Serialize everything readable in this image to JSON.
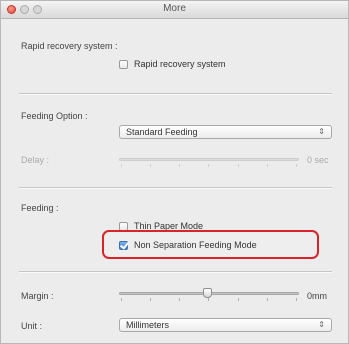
{
  "window": {
    "title": "More"
  },
  "rapid_recovery": {
    "section_label": "Rapid recovery system :",
    "checkbox_label": "Rapid recovery system",
    "checked": false
  },
  "feeding_option": {
    "section_label": "Feeding Option :",
    "selected": "Standard Feeding",
    "delay_label": "Delay :",
    "delay_value": "0 sec",
    "delay_enabled": false
  },
  "feeding": {
    "section_label": "Feeding :",
    "thin_paper_label": "Thin Paper Mode",
    "thin_paper_checked": false,
    "non_separation_label": "Non Separation Feeding Mode",
    "non_separation_checked": true
  },
  "margin": {
    "label": "Margin :",
    "value": "0mm"
  },
  "unit": {
    "label": "Unit :",
    "selected": "Millimeters"
  },
  "icons": {
    "popup_arrow": "up-down-arrows-icon",
    "window_controls": [
      "close-icon",
      "minimize-icon",
      "zoom-icon"
    ]
  },
  "colors": {
    "highlight": "#d8242a",
    "checkbox_checked": "#3a7fd8"
  }
}
